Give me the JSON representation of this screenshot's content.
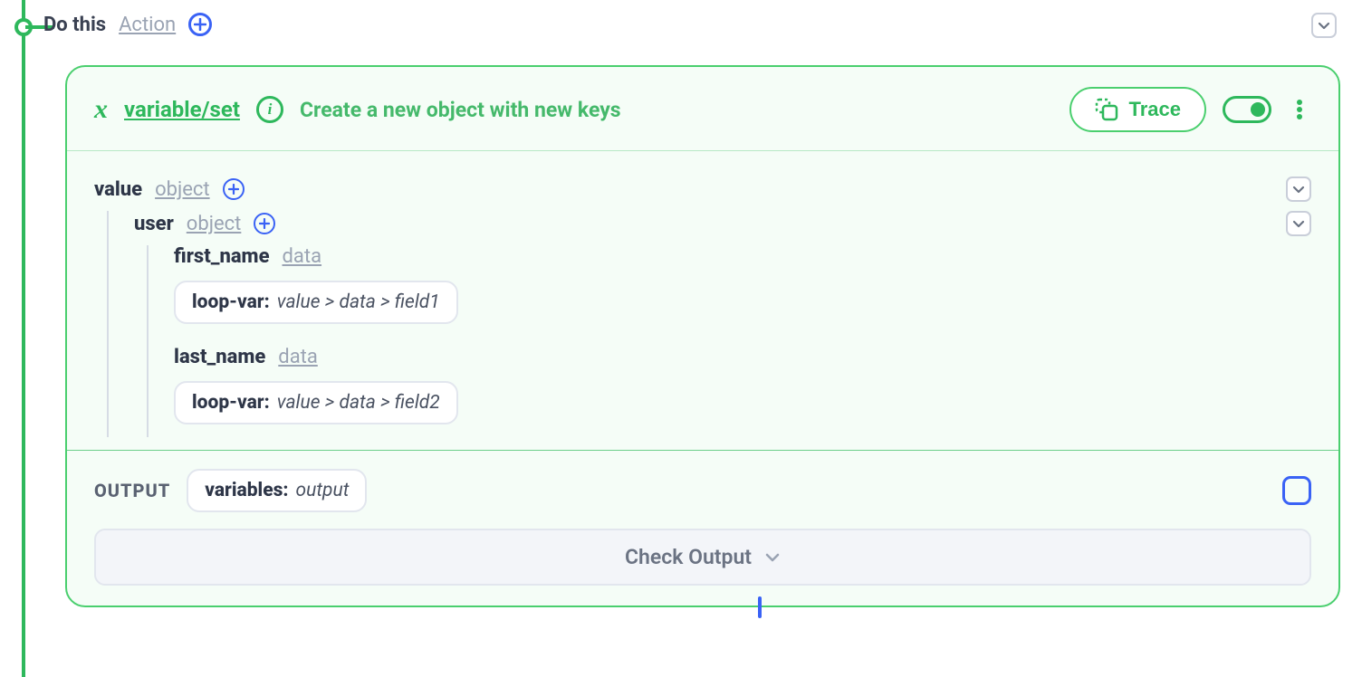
{
  "header": {
    "do_this": "Do this",
    "action_link": "Action"
  },
  "card": {
    "title": "variable/set",
    "description": "Create a new object with new keys",
    "trace_label": "Trace",
    "value": {
      "key": "value",
      "type": "object",
      "user": {
        "key": "user",
        "type": "object",
        "first_name": {
          "key": "first_name",
          "type": "data",
          "pill_key": "loop-var:",
          "pill_val": "value > data > field1"
        },
        "last_name": {
          "key": "last_name",
          "type": "data",
          "pill_key": "loop-var:",
          "pill_val": "value > data > field2"
        }
      }
    },
    "output": {
      "label": "OUTPUT",
      "pill_key": "variables:",
      "pill_val": "output"
    },
    "check_output": "Check Output"
  }
}
